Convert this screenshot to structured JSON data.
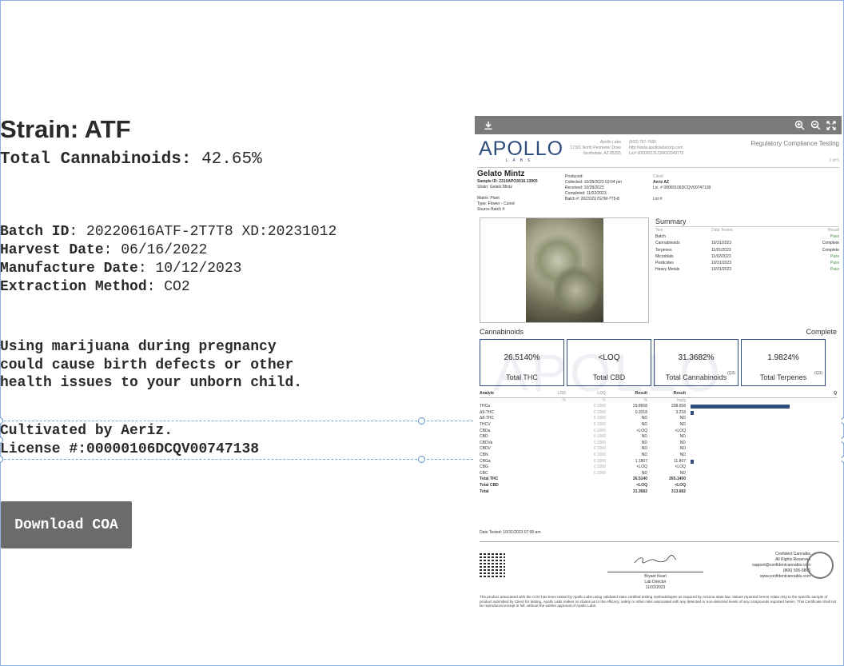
{
  "product": {
    "strain_label": "Strain:",
    "strain_value": "ATF",
    "total_label": "Total Cannabinoids:",
    "total_value": "42.65%",
    "batch_label": "Batch ID",
    "batch_value": ": 20220616ATF-2T7T8 XD:20231012",
    "harvest_label": "Harvest Date",
    "harvest_value": ": 06/16/2022",
    "manufacture_label": "Manufacture Date",
    "manufacture_value": ": 10/12/2023",
    "extraction_label": "Extraction Method",
    "extraction_value": ": CO2",
    "warning": "Using marijuana during pregnancy could cause birth defects or other health issues to your unborn child.",
    "cultivated": "Cultivated by Aeriz.",
    "license": "License #:00000106DCQV00747138",
    "download_label": "Download COA"
  },
  "viewer": {
    "toolbar_icons": [
      "download-icon",
      "zoom-in-icon",
      "zoom-out-icon",
      "fullscreen-icon"
    ],
    "logo": "APOLLO",
    "logo_sub": "LABS",
    "lab_name": "Apollo Labs",
    "lab_addr1": "17301 North Perimeter Drive",
    "lab_addr2": "Scottsdale, AZ 85255",
    "lab_phone": "(602) 767-7600",
    "lab_web": "http://www.apollolabscorp.com",
    "lab_lic": "Lic# 00000013LCRK62049775",
    "reg_title": "Regulatory Compliance Testing",
    "page_of": "1 of 5",
    "product_name": "Gelato Mintz",
    "sample_id": "Sample ID: 2310APO3016.13905",
    "strain": "Strain: Gelato Mintz",
    "matrix": "Matrix: Plant",
    "type": "Type: Flower - Cured",
    "source_batch": "Source Batch #:",
    "produced": "Produced:",
    "collected": "Collected: 10/28/2023 03:04 pm",
    "received": "Received: 10/28/2023",
    "completed": "Completed: 11/02/2023",
    "batch_no": "Batch #: 20231017GTM-7T5-8",
    "client": "Client",
    "client_name": "Aeriz AZ",
    "client_lic": "Lic. # 00000106DCQV00747138",
    "lot": "Lot #:",
    "summary_title": "Summary",
    "summary_head": {
      "test": "Test",
      "date": "Date Tested",
      "result": "Result"
    },
    "summary": [
      {
        "test": "Batch",
        "date": "",
        "result": "Pass"
      },
      {
        "test": "Cannabinoids",
        "date": "10/31/2023",
        "result": "Complete"
      },
      {
        "test": "Terpenes",
        "date": "11/01/2023",
        "result": "Complete"
      },
      {
        "test": "Microbials",
        "date": "11/02/2023",
        "result": "Pass"
      },
      {
        "test": "Pesticides",
        "date": "10/31/2023",
        "result": "Pass"
      },
      {
        "test": "Heavy Metals",
        "date": "10/31/2023",
        "result": "Pass"
      }
    ],
    "cannabinoids_title": "Cannabinoids",
    "cannabinoids_status": "Complete",
    "watermark": "APOLLO",
    "cards": [
      {
        "value": "26.5140%",
        "label": "Total THC",
        "q": ""
      },
      {
        "value": "<LOQ",
        "label": "Total CBD",
        "q": ""
      },
      {
        "value": "31.3682%",
        "label": "Total Cannabinoids",
        "q": "(Q3)"
      },
      {
        "value": "1.9824%",
        "label": "Total Terpenes",
        "q": "(Q3)"
      }
    ],
    "table_head": {
      "analyte": "Analyte",
      "lod": "LOD",
      "loq": "LOQ",
      "r1": "Result",
      "r2": "Result",
      "q": "Q"
    },
    "table_units": {
      "lod": "%",
      "loq": "%",
      "r1": "%",
      "r2": "mg/g"
    },
    "rows": [
      {
        "a": "THCa",
        "lod": "",
        "loq": "0.1000",
        "r1": "29.8658",
        "r2": "298.658",
        "bar": 0.85
      },
      {
        "a": "Δ9-THC",
        "lod": "",
        "loq": "0.1000",
        "r1": "0.3218",
        "r2": "3.218",
        "bar": 0.03
      },
      {
        "a": "Δ8-THC",
        "lod": "",
        "loq": "0.1000",
        "r1": "ND",
        "r2": "ND",
        "bar": 0
      },
      {
        "a": "THCV",
        "lod": "",
        "loq": "0.1000",
        "r1": "ND",
        "r2": "ND",
        "bar": 0
      },
      {
        "a": "CBDa",
        "lod": "",
        "loq": "0.1000",
        "r1": "<LOQ",
        "r2": "<LOQ",
        "bar": 0
      },
      {
        "a": "CBD",
        "lod": "",
        "loq": "0.1000",
        "r1": "ND",
        "r2": "ND",
        "bar": 0
      },
      {
        "a": "CBDVa",
        "lod": "",
        "loq": "0.1000",
        "r1": "ND",
        "r2": "ND",
        "bar": 0
      },
      {
        "a": "CBDV",
        "lod": "",
        "loq": "0.1000",
        "r1": "ND",
        "r2": "ND",
        "bar": 0
      },
      {
        "a": "CBN",
        "lod": "",
        "loq": "0.1000",
        "r1": "ND",
        "r2": "ND",
        "bar": 0
      },
      {
        "a": "CBGa",
        "lod": "",
        "loq": "0.1000",
        "r1": "1.1807",
        "r2": "11.807",
        "bar": 0.03
      },
      {
        "a": "CBG",
        "lod": "",
        "loq": "0.1000",
        "r1": "<LOQ",
        "r2": "<LOQ",
        "bar": 0
      },
      {
        "a": "CBC",
        "lod": "",
        "loq": "0.1000",
        "r1": "ND",
        "r2": "ND",
        "bar": 0
      }
    ],
    "totals": [
      {
        "a": "Total THC",
        "r1": "26.5140",
        "r2": "265.1400"
      },
      {
        "a": "Total CBD",
        "r1": "<LOQ",
        "r2": "<LOQ"
      },
      {
        "a": "Total",
        "r1": "31.3682",
        "r2": "313.682"
      }
    ],
    "date_tested": "Date Tested: 10/31/2023 07:00 am",
    "signer": "Bryant Kearl",
    "signer_title": "Lab Director",
    "sign_date": "11/02/2023",
    "conf1": "Confident Cannabis",
    "conf2": "All Rights Reserved",
    "conf3": "support@confidentcannabis.com",
    "conf4": "(866) 506-5866",
    "conf5": "www.confidentcannabis.com",
    "disclaimer": "The product associated with the COA has been tested by Apollo Labs using validated state certified testing methodologies as required by Arizona state law. Values reported herein relate only to the specific sample of product submitted by Client for testing. Apollo Labs makes no claims as to the efficacy, safety or other risks associated with any detected or non-detected levels of any compounds reported herein. This Certificate shall not be reproduced except in full, without the written approval of Apollo Labs."
  },
  "colors": {
    "accent": "#2f4d7d",
    "button": "#6b6b6b",
    "toolbar": "#7a7a7a",
    "selection": "#7aa7d9"
  }
}
